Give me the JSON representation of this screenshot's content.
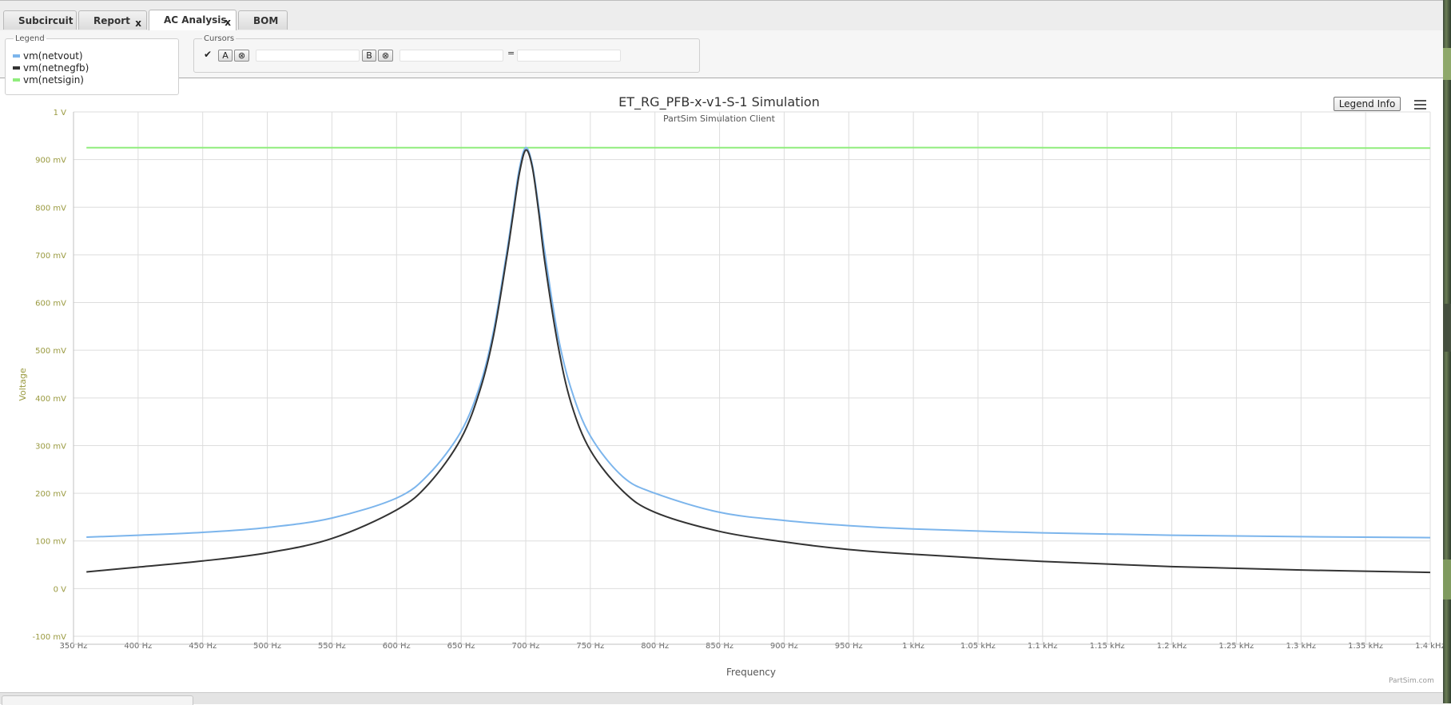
{
  "tabs": [
    {
      "label": "Subcircuit",
      "closable": false,
      "active": false
    },
    {
      "label": "Report",
      "closable": true,
      "active": false
    },
    {
      "label": "AC Analysis",
      "closable": true,
      "active": true
    },
    {
      "label": "BOM",
      "closable": false,
      "active": false
    }
  ],
  "tab_close_glyph": "x",
  "legend_panel": {
    "title": "Legend",
    "items": [
      {
        "label": "vm(netvout)",
        "color": "#7cb5ec"
      },
      {
        "label": "vm(netnegfb)",
        "color": "#333333"
      },
      {
        "label": "vm(netsigin)",
        "color": "#90ed7d"
      }
    ]
  },
  "cursors_panel": {
    "title": "Cursors",
    "check_glyph": "✔",
    "a_label": "A",
    "b_label": "B",
    "clear_glyph": "⊗",
    "equals": "=",
    "a_value": "",
    "b_value": "",
    "diff_value": ""
  },
  "chart": {
    "legend_info_label": "Legend Info",
    "menu_icon": "hamburger-menu-icon",
    "credits": "PartSim.com"
  },
  "chart_data": {
    "type": "line",
    "title": "ET_RG_PFB-x-v1-S-1 Simulation",
    "subtitle": "PartSim Simulation Client",
    "xlabel": "Frequency",
    "ylabel": "Voltage",
    "x_unit": "Hz",
    "y_unit": "V",
    "xlim": [
      350,
      1400
    ],
    "ylim": [
      -0.1,
      1.0
    ],
    "x_ticks": [
      {
        "value": 350,
        "label": "350 Hz"
      },
      {
        "value": 400,
        "label": "400 Hz"
      },
      {
        "value": 450,
        "label": "450 Hz"
      },
      {
        "value": 500,
        "label": "500 Hz"
      },
      {
        "value": 550,
        "label": "550 Hz"
      },
      {
        "value": 600,
        "label": "600 Hz"
      },
      {
        "value": 650,
        "label": "650 Hz"
      },
      {
        "value": 700,
        "label": "700 Hz"
      },
      {
        "value": 750,
        "label": "750 Hz"
      },
      {
        "value": 800,
        "label": "800 Hz"
      },
      {
        "value": 850,
        "label": "850 Hz"
      },
      {
        "value": 900,
        "label": "900 Hz"
      },
      {
        "value": 950,
        "label": "950 Hz"
      },
      {
        "value": 1000,
        "label": "1 kHz"
      },
      {
        "value": 1050,
        "label": "1.05 kHz"
      },
      {
        "value": 1100,
        "label": "1.1 kHz"
      },
      {
        "value": 1150,
        "label": "1.15 kHz"
      },
      {
        "value": 1200,
        "label": "1.2 kHz"
      },
      {
        "value": 1250,
        "label": "1.25 kHz"
      },
      {
        "value": 1300,
        "label": "1.3 kHz"
      },
      {
        "value": 1350,
        "label": "1.35 kHz"
      },
      {
        "value": 1400,
        "label": "1.4 kHz"
      }
    ],
    "y_ticks": [
      {
        "value": -0.1,
        "label": "-100 mV"
      },
      {
        "value": 0,
        "label": "0 V"
      },
      {
        "value": 0.1,
        "label": "100 mV"
      },
      {
        "value": 0.2,
        "label": "200 mV"
      },
      {
        "value": 0.3,
        "label": "300 mV"
      },
      {
        "value": 0.4,
        "label": "400 mV"
      },
      {
        "value": 0.5,
        "label": "500 mV"
      },
      {
        "value": 0.6,
        "label": "600 mV"
      },
      {
        "value": 0.7,
        "label": "700 mV"
      },
      {
        "value": 0.8,
        "label": "800 mV"
      },
      {
        "value": 0.9,
        "label": "900 mV"
      },
      {
        "value": 1.0,
        "label": "1 V"
      }
    ],
    "grid": true,
    "legend": "none",
    "series": [
      {
        "name": "vm(netsigin)",
        "color": "#90ed7d",
        "x": [
          360,
          500,
          650,
          700,
          750,
          900,
          1100,
          1300,
          1400
        ],
        "y": [
          0.925,
          0.925,
          0.925,
          0.925,
          0.925,
          0.925,
          0.925,
          0.924,
          0.924
        ]
      },
      {
        "name": "vm(netvout)",
        "color": "#7cb5ec",
        "x": [
          360,
          400,
          450,
          500,
          550,
          600,
          625,
          650,
          665,
          675,
          685,
          690,
          695,
          700,
          705,
          710,
          715,
          725,
          735,
          750,
          775,
          800,
          850,
          900,
          950,
          1000,
          1100,
          1200,
          1300,
          1400
        ],
        "y": [
          0.108,
          0.112,
          0.118,
          0.128,
          0.148,
          0.19,
          0.24,
          0.33,
          0.43,
          0.54,
          0.7,
          0.79,
          0.88,
          0.925,
          0.89,
          0.8,
          0.7,
          0.53,
          0.42,
          0.32,
          0.235,
          0.2,
          0.16,
          0.143,
          0.132,
          0.125,
          0.117,
          0.112,
          0.109,
          0.107
        ]
      },
      {
        "name": "vm(netnegfb)",
        "color": "#333333",
        "x": [
          360,
          400,
          450,
          500,
          550,
          600,
          625,
          650,
          665,
          675,
          685,
          690,
          695,
          700,
          705,
          710,
          715,
          725,
          735,
          750,
          775,
          800,
          850,
          900,
          950,
          1000,
          1100,
          1200,
          1300,
          1400
        ],
        "y": [
          0.035,
          0.045,
          0.058,
          0.075,
          0.105,
          0.165,
          0.22,
          0.315,
          0.42,
          0.53,
          0.69,
          0.78,
          0.87,
          0.92,
          0.885,
          0.79,
          0.68,
          0.51,
          0.39,
          0.29,
          0.205,
          0.16,
          0.12,
          0.098,
          0.082,
          0.072,
          0.057,
          0.046,
          0.039,
          0.034
        ]
      }
    ]
  }
}
